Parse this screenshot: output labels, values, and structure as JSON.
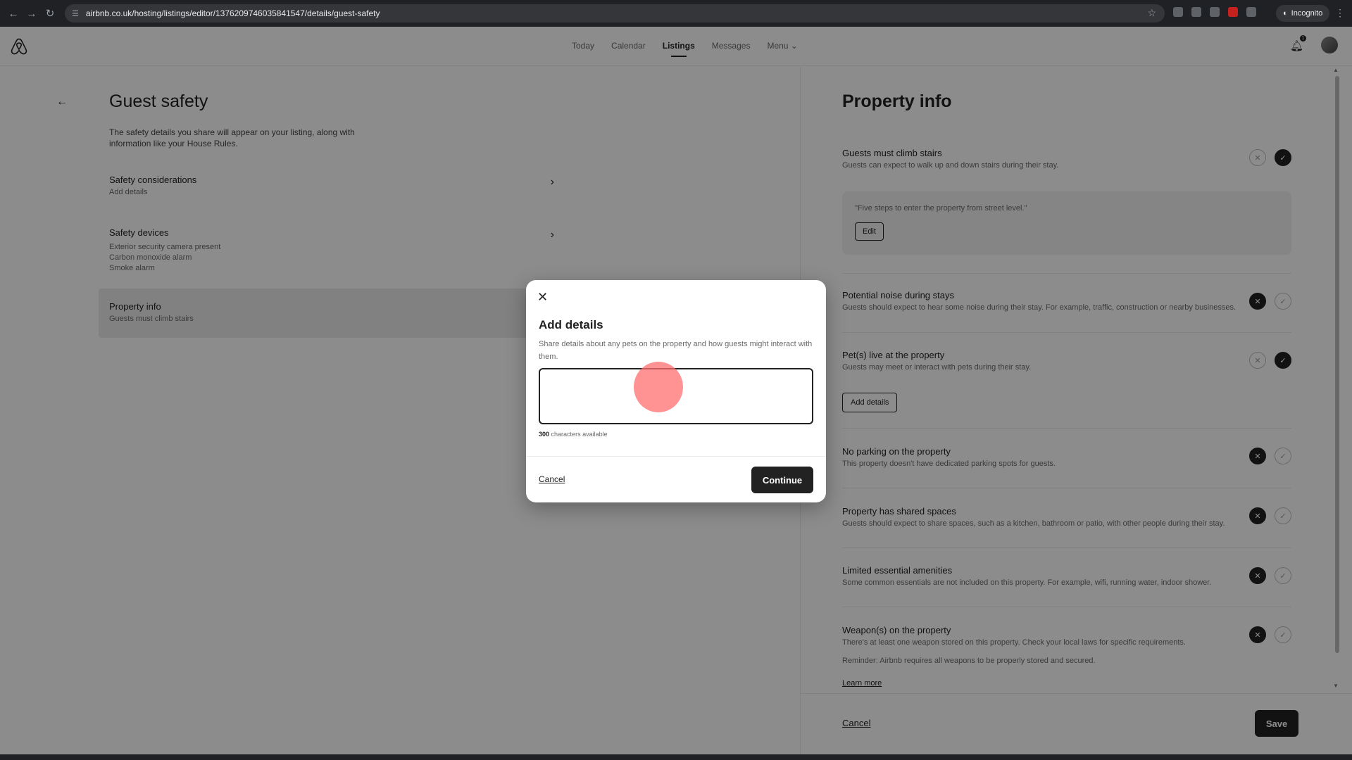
{
  "browser": {
    "url": "airbnb.co.uk/hosting/listings/editor/1376209746035841547/details/guest-safety",
    "incognito_label": "Incognito"
  },
  "nav": {
    "items": [
      "Today",
      "Calendar",
      "Listings",
      "Messages",
      "Menu"
    ],
    "active": "Listings",
    "notification_count": "1"
  },
  "left": {
    "title": "Guest safety",
    "description": "The safety details you share will appear on your listing, along with information like your House Rules.",
    "rows": [
      {
        "title": "Safety considerations",
        "sub": [
          "Add details"
        ]
      },
      {
        "title": "Safety devices",
        "sub": [
          "Exterior security camera present",
          "Carbon monoxide alarm",
          "Smoke alarm"
        ]
      },
      {
        "title": "Property info",
        "sub": [
          "Guests must climb stairs"
        ]
      }
    ]
  },
  "right": {
    "title": "Property info",
    "items": [
      {
        "title": "Guests must climb stairs",
        "desc": "Guests can expect to walk up and down stairs during their stay.",
        "state": "yes"
      },
      {
        "title": "Potential noise during stays",
        "desc": "Guests should expect to hear some noise during their stay. For example, traffic, construction or nearby businesses.",
        "state": "no"
      },
      {
        "title": "Pet(s) live at the property",
        "desc": "Guests may meet or interact with pets during their stay.",
        "state": "yes"
      },
      {
        "title": "No parking on the property",
        "desc": "This property doesn't have dedicated parking spots for guests.",
        "state": "no"
      },
      {
        "title": "Property has shared spaces",
        "desc": "Guests should expect to share spaces, such as a kitchen, bathroom or patio, with other people during their stay.",
        "state": "no"
      },
      {
        "title": "Limited essential amenities",
        "desc": "Some common essentials are not included on this property. For example, wifi, running water, indoor shower.",
        "state": "no"
      },
      {
        "title": "Weapon(s) on the property",
        "desc": "There's at least one weapon stored on this property. Check your local laws for specific requirements.",
        "state": "no"
      }
    ],
    "stairs_quote": "\"Five steps to enter the property from street level.\"",
    "edit_label": "Edit",
    "add_details_label": "Add details",
    "reminder": "Reminder: Airbnb requires all weapons to be properly stored and secured.",
    "learn_more": "Learn more",
    "cancel": "Cancel",
    "save": "Save"
  },
  "modal": {
    "title": "Add details",
    "description": "Share details about any pets on the property and how guests might interact with them.",
    "textarea_value": "",
    "char_count_num": "300",
    "char_count_label": "characters available",
    "cancel": "Cancel",
    "continue": "Continue"
  }
}
